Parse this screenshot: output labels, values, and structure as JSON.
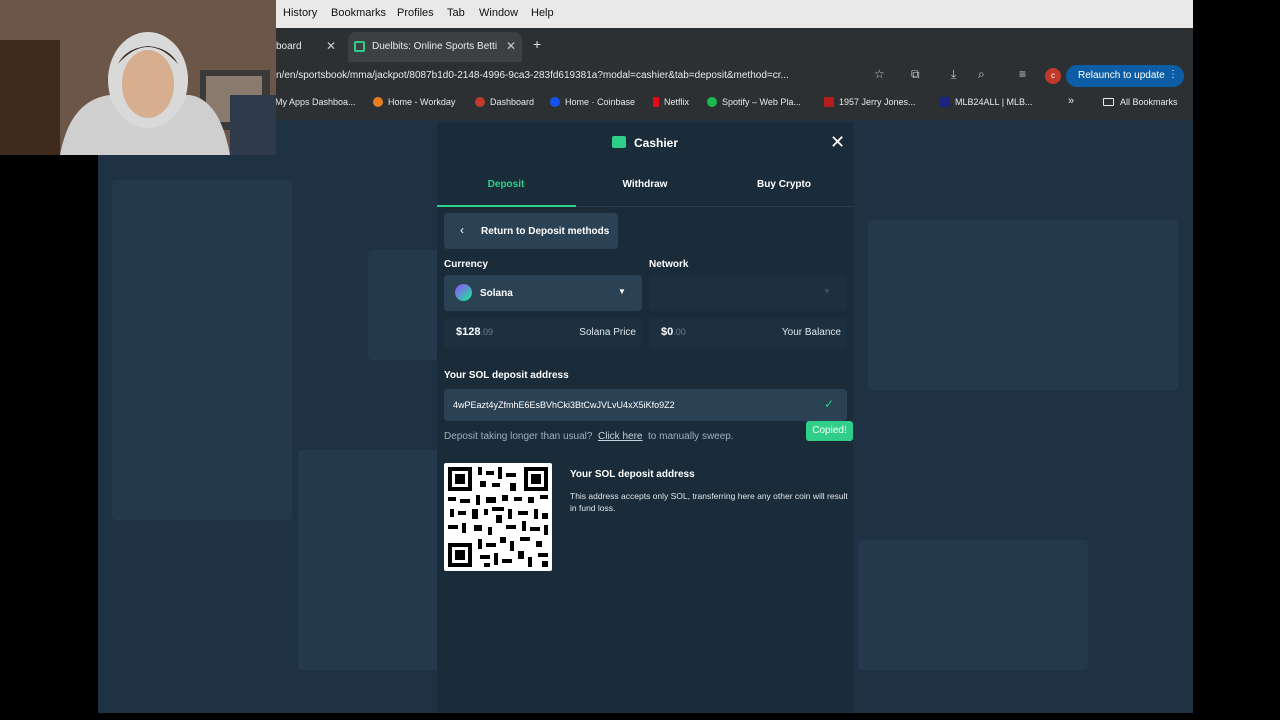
{
  "menubar": {
    "items": [
      "History",
      "Bookmarks",
      "Profiles",
      "Tab",
      "Window",
      "Help"
    ]
  },
  "browser": {
    "tabs": [
      {
        "title": "board",
        "active": false
      },
      {
        "title": "Duelbits: Online Sports Betti",
        "active": true
      }
    ],
    "new_tab": "+",
    "url": "n/en/sportsbook/mma/jackpot/8087b1d0-2148-4996-9ca3-283fd619381a?modal=cashier&tab=deposit&method=cr...",
    "profile_initial": "c",
    "relaunch_label": "Relaunch to update",
    "bookmarks": [
      "My Apps Dashboa...",
      "Home - Workday",
      "Dashboard",
      "Home · Coinbase",
      "Netflix",
      "Spotify – Web Pla...",
      "1957 Jerry Jones...",
      "MLB24ALL | MLB..."
    ],
    "bookmarks_overflow": "»",
    "all_bookmarks": "All Bookmarks"
  },
  "modal": {
    "title": "Cashier",
    "close": "✕",
    "tabs": [
      "Deposit",
      "Withdraw",
      "Buy Crypto"
    ],
    "active_tab": "Deposit",
    "back_label": "Return to Deposit methods",
    "currency_label": "Currency",
    "network_label": "Network",
    "currency_value": "Solana",
    "network_value": "",
    "price": {
      "whole": "$128",
      "dec": ".09",
      "label": "Solana Price"
    },
    "balance": {
      "whole": "$0",
      "dec": ".00",
      "label": "Your Balance"
    },
    "address_label": "Your SOL deposit address",
    "address": "4wPEazt4yZfmhE6EsBVhCki3BtCwJVLvU4xX5iKfo9Z2",
    "copied": "Copied!",
    "help_prefix": "Deposit taking longer than usual?",
    "help_link": "Click here",
    "help_suffix": "to manually sweep.",
    "qr_title": "Your SOL deposit address",
    "qr_desc": "This address accepts only SOL, transferring here any other coin will result in fund loss."
  },
  "colors": {
    "accent": "#2fcf8a",
    "modal_bg": "#1a2c3a",
    "field_bg": "#2b4254"
  }
}
